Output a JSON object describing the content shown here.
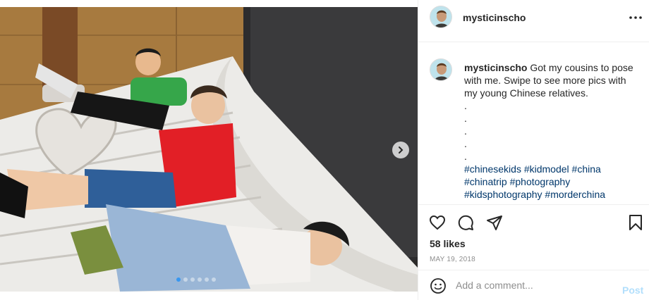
{
  "header": {
    "username": "mysticinscho"
  },
  "caption": {
    "username": "mysticinscho",
    "text": "Got my cousins to pose with me. Swipe to see more pics with my young Chinese relatives.",
    "dots": [
      ".",
      ".",
      ".",
      ".",
      "."
    ],
    "hashtags": [
      "#chinesekids",
      "#kidmodel",
      "#china",
      "#chinatrip",
      "#photography",
      "#kidsphotography",
      "#morderchina"
    ]
  },
  "carousel": {
    "slide_count": 6,
    "current_slide": 1
  },
  "actions": {
    "likes": "58 likes",
    "date": "MAY 19, 2018"
  },
  "comment": {
    "placeholder": "Add a comment...",
    "post_label": "Post"
  },
  "colors": {
    "link": "#00376b",
    "post_disabled": "#b2dffc",
    "carousel_active": "#3897f0"
  },
  "icons": [
    "more-icon",
    "chevron-right-icon",
    "heart-icon",
    "comment-icon",
    "share-icon",
    "bookmark-icon",
    "emoji-icon"
  ]
}
